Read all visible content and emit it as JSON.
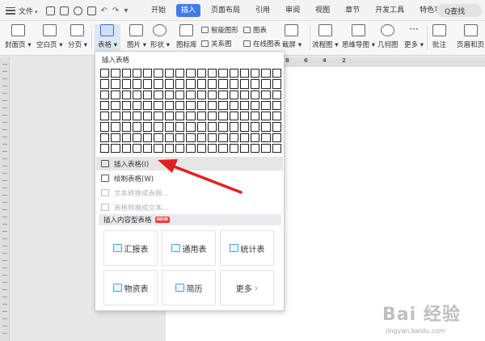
{
  "menubar": {
    "file_label": "文件",
    "tabs": [
      {
        "label": "开始"
      },
      {
        "label": "插入"
      },
      {
        "label": "页面布局"
      },
      {
        "label": "引用"
      },
      {
        "label": "审阅"
      },
      {
        "label": "视图"
      },
      {
        "label": "章节"
      },
      {
        "label": "开发工具"
      },
      {
        "label": "特色功能"
      }
    ],
    "active_tab": "插入",
    "search_label": "Q查找"
  },
  "ribbon": {
    "cover_label": "封面页",
    "blank_label": "空白页",
    "pagebreak_label": "分页",
    "table_label": "表格",
    "picture_label": "图片",
    "shape_label": "形状",
    "iconlib_label": "图标库",
    "smartart_label": "智能图形",
    "relation_label": "关系图",
    "chart_label": "图表",
    "online_chart_label": "在线图表",
    "screenshot_label": "截屏",
    "flowchart_label": "流程图",
    "mindmap_label": "思维导图",
    "geometry_label": "几何图",
    "more_label": "更多",
    "comment_label": "批注",
    "header_footer_label": "页眉和页"
  },
  "ruler": {
    "ticks": [
      "8",
      "6",
      "4",
      "2"
    ]
  },
  "panel": {
    "title": "插入表格",
    "grid_cols": 17,
    "grid_rows": 8,
    "items": [
      {
        "label": "插入表格(I)",
        "state": "selected"
      },
      {
        "label": "绘制表格(W)",
        "state": "normal"
      },
      {
        "label": "文本转换成表格...",
        "state": "disabled"
      },
      {
        "label": "表格转换成文本...",
        "state": "disabled"
      }
    ],
    "section_title": "插入内容型表格",
    "section_badge": "NEW",
    "cards": [
      {
        "label": "汇报表"
      },
      {
        "label": "通用表"
      },
      {
        "label": "统计表"
      },
      {
        "label": "物资表"
      },
      {
        "label": "简历"
      },
      {
        "label": "更多"
      }
    ]
  },
  "watermark": {
    "brand": "Bai 经验",
    "url": "jingyan.baidu.com"
  },
  "colors": {
    "accent": "#3f7ce8",
    "arrow": "#e02020",
    "badge": "#e7413b"
  }
}
